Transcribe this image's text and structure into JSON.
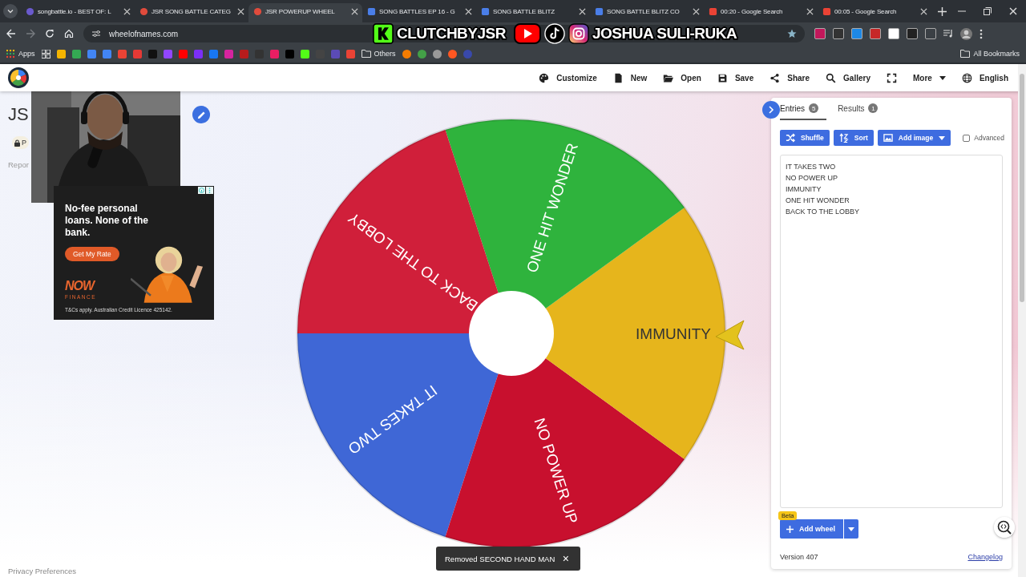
{
  "browser": {
    "tabs": [
      {
        "title": "songbattle.io - BEST OF: L",
        "selected": false
      },
      {
        "title": "JSR SONG BATTLE CATEG",
        "selected": false
      },
      {
        "title": "JSR POWERUP WHEEL",
        "selected": true
      },
      {
        "title": "SONG BATTLES EP 16 - G",
        "selected": false
      },
      {
        "title": "SONG BATTLE BLITZ",
        "selected": false
      },
      {
        "title": "SONG BATTLE BLITZ CO",
        "selected": false
      },
      {
        "title": "00:20 - Google Search",
        "selected": false
      },
      {
        "title": "00:05 - Google Search",
        "selected": false
      }
    ],
    "forward": {
      "disabled": true
    },
    "address": "wheelofnames.com",
    "bookmarks": {
      "apps": "Apps",
      "others": "Others",
      "all_bookmarks": "All Bookmarks"
    }
  },
  "stream_overlay": {
    "channel": "CLUTCHBYJSR",
    "name": "JOSHUA SULI-RUKA"
  },
  "ad": {
    "headline": "No-fee personal loans. None of the bank.",
    "cta": "Get My Rate",
    "brand": "NOW",
    "brand_sub": "FINANCE",
    "fine_print": "T&Cs apply. Australian Credit Licence 425142."
  },
  "app": {
    "toolbar": [
      {
        "kind": "button",
        "label": "Customize"
      },
      {
        "kind": "button",
        "label": "New"
      },
      {
        "kind": "button",
        "label": "Open"
      },
      {
        "kind": "button",
        "label": "Save"
      },
      {
        "kind": "button",
        "label": "Share"
      },
      {
        "kind": "button",
        "label": "Gallery"
      },
      {
        "kind": "icon"
      },
      {
        "kind": "menu",
        "label": "More"
      },
      {
        "kind": "button",
        "label": "English"
      }
    ],
    "title": "JS",
    "visibility": "P",
    "report": "Repor",
    "wheel": {
      "segments": [
        {
          "label": "IT TAKES TWO",
          "color": "#3f67d6"
        },
        {
          "label": "NO POWER UP",
          "color": "#c8102e"
        },
        {
          "label": "IMMUNITY",
          "color": "#e6b51c"
        },
        {
          "label": "ONE HIT WONDER",
          "color": "#2fb33d"
        },
        {
          "label": "BACK TO THE LOBBY",
          "color": "#d01f3a"
        }
      ]
    },
    "panel": {
      "tabs": [
        {
          "label": "Entries",
          "count": "5",
          "selected": true
        },
        {
          "label": "Results",
          "count": "1",
          "selected": false
        }
      ],
      "buttons": [
        {
          "kind": "button",
          "label": "Shuffle"
        },
        {
          "kind": "button",
          "label": "Sort"
        },
        {
          "kind": "menu",
          "label": "Add image"
        }
      ],
      "advanced": {
        "label": "Advanced",
        "checked": false
      },
      "entries": [
        "IT TAKES TWO",
        "NO POWER UP",
        "IMMUNITY",
        "ONE HIT WONDER",
        "BACK TO THE LOBBY"
      ],
      "add_wheel": {
        "label": "Add wheel",
        "badge": "Beta"
      },
      "version": "Version 407",
      "changelog": "Changelog"
    },
    "toast": {
      "message": "Removed SECOND HAND MAN",
      "close": "×"
    },
    "privacy": "Privacy Preferences"
  }
}
